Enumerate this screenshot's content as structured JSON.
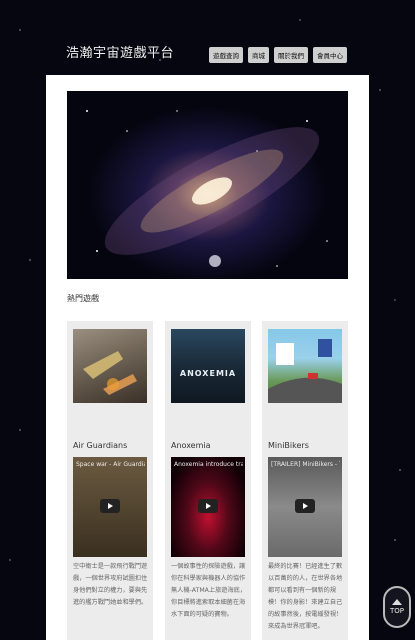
{
  "header": {
    "site_title": "浩瀚宇宙遊戲平台",
    "nav": [
      "遊戲查詢",
      "商城",
      "關於我們",
      "會員中心"
    ]
  },
  "main": {
    "section_title": "熱門遊戲",
    "games": [
      {
        "name": "Air Guardians",
        "video_title": "Space war - Air Guardians ...",
        "description": "空中衛士是一款飛行戰鬥遊戲，一個世界攻府試圖扣住身他們對立的權力，要與先進的艦方戰鬥她並和學們。"
      },
      {
        "name": "Anoxemia",
        "thumb_label": "ANOXEMIA",
        "video_title": "Anoxemia introduce trailer",
        "description": "一個故事性的探險遊戲，讓你在科學家與機器人的協作無人機-ATMA上旅遊海底，你目標將進索取本細菌在海水下面的可疑的寶物。"
      },
      {
        "name": "MiniBikers",
        "video_title": "[TRAILER] MiniBikers - Th...",
        "description": "最終的比賽！已經進生了數以百萬的的人，在世界各地都可以看到有一個新的規模！你的身影！來建立自己的故事然後，按電緩發視！來成為世界冠軍吧。"
      }
    ]
  },
  "scroll_top": {
    "label": "TOP"
  },
  "colors": {
    "page_bg": "#05060f",
    "panel_bg": "#ffffff",
    "card_bg": "#ececec",
    "nav_bg": "#cfcfcf"
  }
}
